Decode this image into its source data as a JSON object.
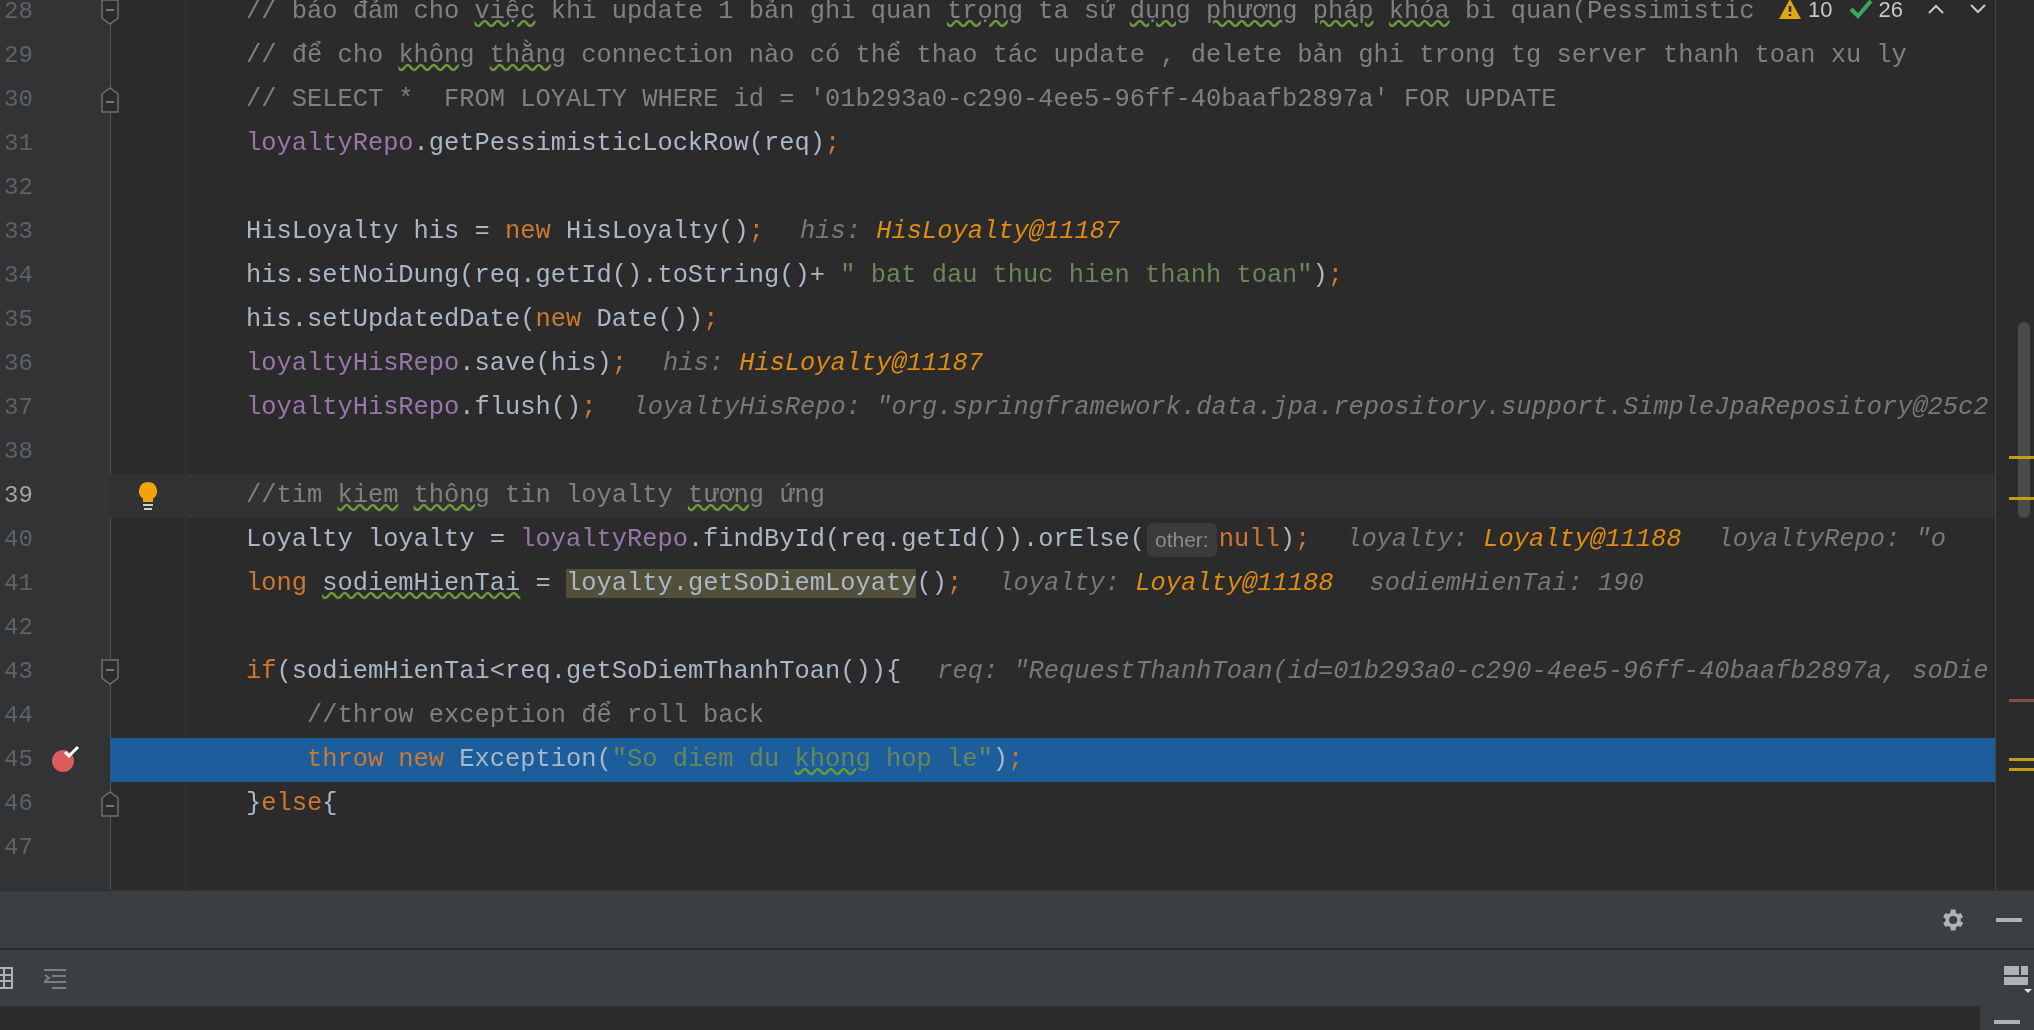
{
  "editor": {
    "inspections": {
      "warnings": "10",
      "passed": "26"
    },
    "lines": [
      {
        "number": "28",
        "current": false,
        "executing": false,
        "gutter_icon": {
          "kind": "fold_start"
        },
        "segments": [
          {
            "kind": "code",
            "tokens": [
              {
                "text": "// báo đảm cho ",
                "kind": "comment"
              },
              {
                "text": "việc",
                "kind": "comment",
                "typo": true
              },
              {
                "text": " khi update 1 bản ghi quan ",
                "kind": "comment"
              },
              {
                "text": "trọng",
                "kind": "comment",
                "typo": true
              },
              {
                "text": " ta sử ",
                "kind": "comment"
              },
              {
                "text": "dụng",
                "kind": "comment",
                "typo": true
              },
              {
                "text": " phương",
                "kind": "comment",
                "typo": true
              },
              {
                "text": " pháp",
                "kind": "comment",
                "typo": true
              },
              {
                "text": " khóa",
                "kind": "comment",
                "typo": true
              },
              {
                "text": " bi quan(Pessimistic",
                "kind": "comment"
              }
            ]
          }
        ]
      },
      {
        "number": "29",
        "current": false,
        "executing": false,
        "segments": [
          {
            "kind": "code",
            "tokens": [
              {
                "text": "// để cho ",
                "kind": "comment"
              },
              {
                "text": "không",
                "kind": "comment",
                "typo": true
              },
              {
                "text": " thằng",
                "kind": "comment",
                "typo": true
              },
              {
                "text": " connection nào có thể thao tác update , delete bản ghi trong tg server thanh toan xu ly",
                "kind": "comment"
              }
            ]
          }
        ]
      },
      {
        "number": "30",
        "current": false,
        "executing": false,
        "gutter_icon": {
          "kind": "fold_end"
        },
        "segments": [
          {
            "kind": "code",
            "tokens": [
              {
                "text": "// SELECT *  FROM LOYALTY WHERE id = '01b293a0-c290-4ee5-96ff-40baafb2897a' FOR UPDATE",
                "kind": "comment"
              }
            ]
          }
        ]
      },
      {
        "number": "31",
        "current": false,
        "executing": false,
        "segments": [
          {
            "kind": "code",
            "tokens": [
              {
                "text": "loyaltyRepo",
                "kind": "field"
              },
              {
                "text": ".getPessimisticLockRow(req)",
                "kind": "plain"
              },
              {
                "text": ";",
                "kind": "keyword"
              }
            ]
          }
        ]
      },
      {
        "number": "32",
        "current": false,
        "executing": false
      },
      {
        "number": "33",
        "current": false,
        "executing": false,
        "segments": [
          {
            "kind": "code",
            "tokens": [
              {
                "text": "HisLoyalty his = ",
                "kind": "plain"
              },
              {
                "text": "new",
                "kind": "keyword"
              },
              {
                "text": " HisLoyalty()",
                "kind": "plain"
              },
              {
                "text": ";",
                "kind": "keyword"
              }
            ]
          },
          {
            "kind": "hint",
            "label": "his:",
            "value": "HisLoyalty@11187"
          }
        ]
      },
      {
        "number": "34",
        "current": false,
        "executing": false,
        "segments": [
          {
            "kind": "code",
            "tokens": [
              {
                "text": "his.setNoiDung(req.getId().toString()+ ",
                "kind": "plain"
              },
              {
                "text": "\" bat dau thuc hien thanh toan\"",
                "kind": "string"
              },
              {
                "text": ")",
                "kind": "plain"
              },
              {
                "text": ";",
                "kind": "keyword"
              }
            ]
          }
        ]
      },
      {
        "number": "35",
        "current": false,
        "executing": false,
        "segments": [
          {
            "kind": "code",
            "tokens": [
              {
                "text": "his.setUpdatedDate(",
                "kind": "plain"
              },
              {
                "text": "new",
                "kind": "keyword"
              },
              {
                "text": " Date())",
                "kind": "plain"
              },
              {
                "text": ";",
                "kind": "keyword"
              }
            ]
          }
        ]
      },
      {
        "number": "36",
        "current": false,
        "executing": false,
        "segments": [
          {
            "kind": "code",
            "tokens": [
              {
                "text": "loyaltyHisRepo",
                "kind": "field"
              },
              {
                "text": ".save(his)",
                "kind": "plain"
              },
              {
                "text": ";",
                "kind": "keyword"
              }
            ]
          },
          {
            "kind": "hint",
            "label": "his:",
            "value": "HisLoyalty@11187"
          }
        ]
      },
      {
        "number": "37",
        "current": false,
        "executing": false,
        "segments": [
          {
            "kind": "code",
            "tokens": [
              {
                "text": "loyaltyHisRepo",
                "kind": "field"
              },
              {
                "text": ".flush()",
                "kind": "plain"
              },
              {
                "text": ";",
                "kind": "keyword"
              }
            ]
          },
          {
            "kind": "hint",
            "label": "loyaltyHisRepo: \"org.springframework.data.jpa.repository.support.SimpleJpaRepository@25c2"
          }
        ]
      },
      {
        "number": "38",
        "current": false,
        "executing": false
      },
      {
        "number": "39",
        "current": true,
        "executing": false,
        "gutter_icon": {
          "kind": "bulb"
        },
        "segments": [
          {
            "kind": "code",
            "tokens": [
              {
                "text": "//tim ",
                "kind": "comment"
              },
              {
                "text": "kiem",
                "kind": "comment",
                "typo": true
              },
              {
                "text": " thông",
                "kind": "comment",
                "typo": true
              },
              {
                "text": " tin loyalty ",
                "kind": "comment"
              },
              {
                "text": "tương",
                "kind": "comment",
                "typo": true
              },
              {
                "text": " ứng",
                "kind": "comment"
              }
            ]
          }
        ]
      },
      {
        "number": "40",
        "current": false,
        "executing": false,
        "segments": [
          {
            "kind": "code",
            "tokens": [
              {
                "text": "Loyalty loyalty = ",
                "kind": "plain"
              },
              {
                "text": "loyaltyRepo",
                "kind": "field"
              },
              {
                "text": ".findById(req.getId()).orElse(",
                "kind": "plain"
              }
            ]
          },
          {
            "kind": "param",
            "label": "other:"
          },
          {
            "kind": "code",
            "tokens": [
              {
                "text": "null",
                "kind": "keyword"
              },
              {
                "text": ")",
                "kind": "plain"
              },
              {
                "text": ";",
                "kind": "keyword"
              }
            ]
          },
          {
            "kind": "hint",
            "label": "loyalty:",
            "value": "Loyalty@11188"
          },
          {
            "kind": "hint",
            "label": "loyaltyRepo: \"o"
          }
        ]
      },
      {
        "number": "41",
        "current": false,
        "executing": false,
        "segments": [
          {
            "kind": "code",
            "tokens": [
              {
                "text": "long ",
                "kind": "keyword"
              },
              {
                "text": "sodiemHienTai",
                "kind": "plain",
                "typo": true
              },
              {
                "text": " = ",
                "kind": "plain"
              },
              {
                "text": "loyalty.getSoDiemLoyaty",
                "kind": "plain",
                "usage": true
              },
              {
                "text": "()",
                "kind": "plain"
              },
              {
                "text": ";",
                "kind": "keyword"
              }
            ]
          },
          {
            "kind": "hint",
            "label": "loyalty:",
            "value": "Loyalty@11188"
          },
          {
            "kind": "hint",
            "label": "sodiemHienTai: 190"
          }
        ]
      },
      {
        "number": "42",
        "current": false,
        "executing": false
      },
      {
        "number": "43",
        "current": false,
        "executing": false,
        "gutter_icon": {
          "kind": "fold_start"
        },
        "segments": [
          {
            "kind": "code",
            "tokens": [
              {
                "text": "if",
                "kind": "keyword"
              },
              {
                "text": "(sodiemHienTai<req.getSoDiemThanhToan()){",
                "kind": "plain"
              }
            ]
          },
          {
            "kind": "hint",
            "label": "req: \"RequestThanhToan(id=01b293a0-c290-4ee5-96ff-40baafb2897a, soDie"
          }
        ]
      },
      {
        "number": "44",
        "current": false,
        "executing": false,
        "segments": [
          {
            "kind": "code",
            "tokens": [
              {
                "text": "    //throw exception để roll back",
                "kind": "comment"
              }
            ]
          }
        ]
      },
      {
        "number": "45",
        "current": false,
        "executing": true,
        "gutter_icon": {
          "kind": "breakpoint"
        },
        "segments": [
          {
            "kind": "code",
            "tokens": [
              {
                "text": "    throw new",
                "kind": "keyword"
              },
              {
                "text": " Exception(",
                "kind": "plain"
              },
              {
                "text": "\"So diem du ",
                "kind": "string"
              },
              {
                "text": "khong",
                "kind": "string",
                "typo": true
              },
              {
                "text": " hop le\"",
                "kind": "string"
              },
              {
                "text": ")",
                "kind": "plain"
              },
              {
                "text": ";",
                "kind": "keyword"
              }
            ]
          }
        ]
      },
      {
        "number": "46",
        "current": false,
        "executing": false,
        "gutter_icon": {
          "kind": "fold_end"
        },
        "segments": [
          {
            "kind": "code",
            "tokens": [
              {
                "text": "}",
                "kind": "plain"
              },
              {
                "text": "else",
                "kind": "keyword"
              },
              {
                "text": "{",
                "kind": "plain"
              }
            ]
          }
        ]
      },
      {
        "number": "47",
        "current": false,
        "executing": false
      }
    ]
  }
}
